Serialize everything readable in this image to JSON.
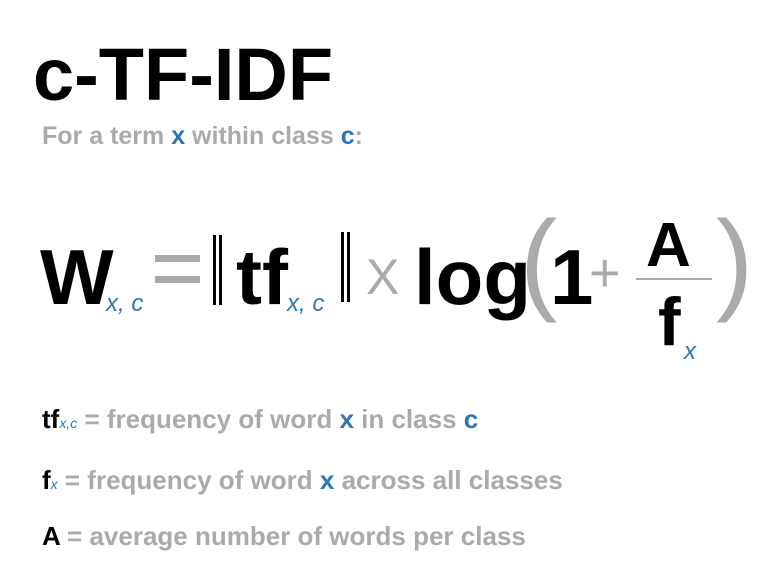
{
  "title": "c-TF-IDF",
  "subtitle": {
    "prefix": "For a term ",
    "term": "x",
    "middle": " within class ",
    "cls": "c",
    "suffix": ":"
  },
  "formula": {
    "lhs": "W",
    "lhs_sub": "x, c",
    "equals": "=",
    "tf": "tf",
    "tf_sub": "x, c",
    "times": "X",
    "log": "log",
    "open_paren": "(",
    "one": "1",
    "plus": "+",
    "numerator": "A",
    "denominator": "f",
    "denominator_sub": "x",
    "close_paren": ")"
  },
  "legend": [
    {
      "symbol": "tf",
      "sub": "x,c",
      "text1": " = frequency of word ",
      "var1": "x",
      "text2": " in class ",
      "var2": "c"
    },
    {
      "symbol": "f",
      "sub": "x",
      "text1": " = frequency of word ",
      "var1": "x",
      "text2": " across all classes"
    },
    {
      "symbol": "A",
      "text1": " = average number of words per class"
    }
  ],
  "colors": {
    "accent": "#2e75b6",
    "muted": "#aaaaaa",
    "text": "#000000"
  }
}
